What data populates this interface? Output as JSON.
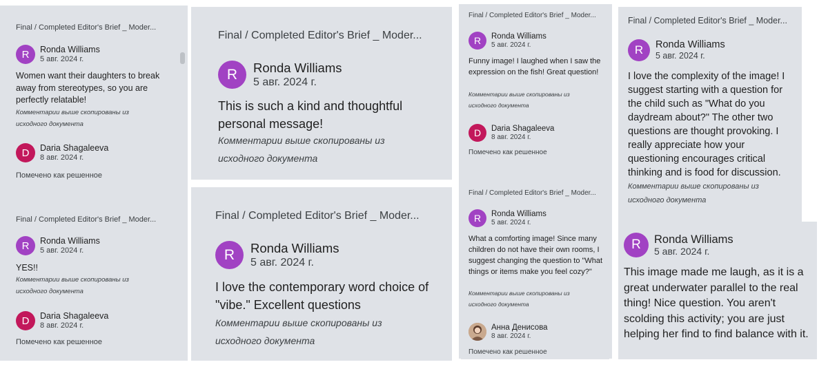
{
  "doc_title": "Final / Completed Editor's Brief _ Moder...",
  "copied_note": "Комментарии выше скопированы из исходного документа",
  "resolved_label": "Помечено как решенное",
  "users": {
    "rw": {
      "name": "Ronda Williams",
      "date": "5 авг. 2024 г.",
      "initial": "R"
    },
    "ds": {
      "name": "Daria Shagaleeva",
      "date": "8 авг. 2024 г.",
      "initial": "D"
    },
    "ad": {
      "name": "Анна Денисова",
      "date": "8 авг. 2024 г."
    }
  },
  "comments": {
    "c1": "Women want their daughters to break away from stereotypes, so you are perfectly relatable!",
    "c2": "YES!!",
    "c3": "This is such a kind and thoughtful personal message!",
    "c4": "I love the contemporary word choice of \"vibe.\" Excellent questions",
    "c5": "Funny image! I laughed when I saw the expression on the fish! Great question!",
    "c6": "What a comforting image! Since many children do not have their own rooms, I suggest changing the question to \"What things or items make you feel cozy?\"",
    "c7": "I love the complexity of the image! I suggest starting with a question for the child such as \"What do you daydream about?\" The other two questions are thought provoking. I really appreciate how your questioning encourages critical thinking and is food for discussion.",
    "c8": "This image made me laugh, as it is a great underwater parallel to the real thing! Nice question. You aren't scolding this activity; you are just helping her find to find balance with it."
  },
  "colors": {
    "ronda_avatar": "#a142c3",
    "daria_avatar": "#c2185b",
    "card_bg": "#dfe2e7"
  }
}
